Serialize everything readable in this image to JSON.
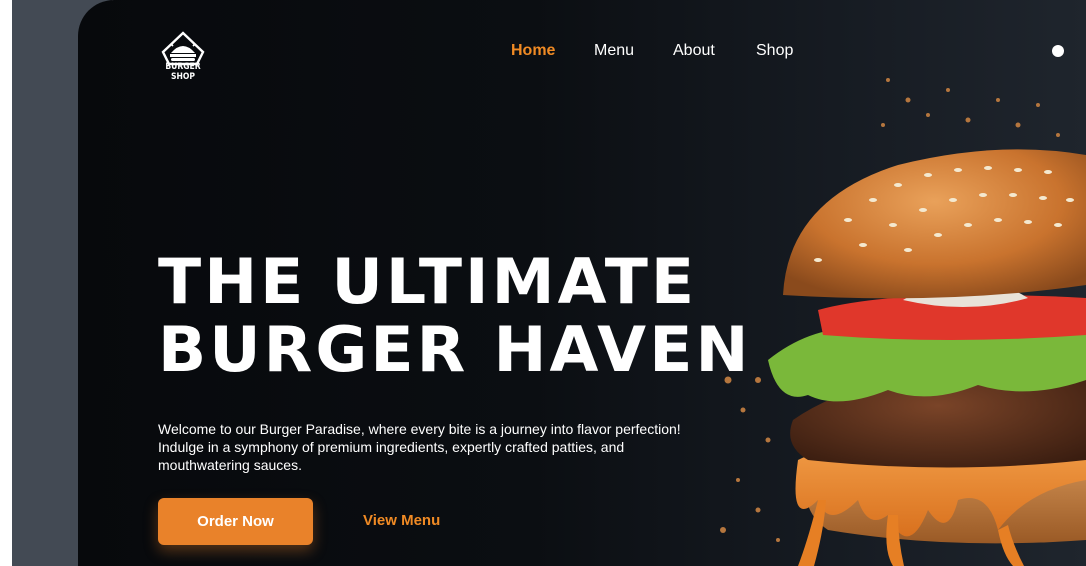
{
  "brand": {
    "name": "BURGER SHOP"
  },
  "nav": {
    "items": [
      {
        "label": "Home",
        "active": true
      },
      {
        "label": "Menu",
        "active": false
      },
      {
        "label": "About",
        "active": false
      },
      {
        "label": "Shop",
        "active": false
      }
    ]
  },
  "hero": {
    "headline_line1": "THE ULTIMATE",
    "headline_line2": "BURGER HAVEN",
    "description": "Welcome to our Burger Paradise, where every bite is a journey into flavor perfection! Indulge in a symphony of premium ingredients, expertly crafted patties, and mouthwatering sauces.",
    "order_button": "Order Now",
    "view_menu_link": "View Menu"
  },
  "icons": {
    "search": "search-icon",
    "logo": "burger-logo-icon"
  },
  "colors": {
    "accent": "#f08a24",
    "button": "#e9822a",
    "background": "#0b0e12",
    "side_panel": "#434a54"
  }
}
